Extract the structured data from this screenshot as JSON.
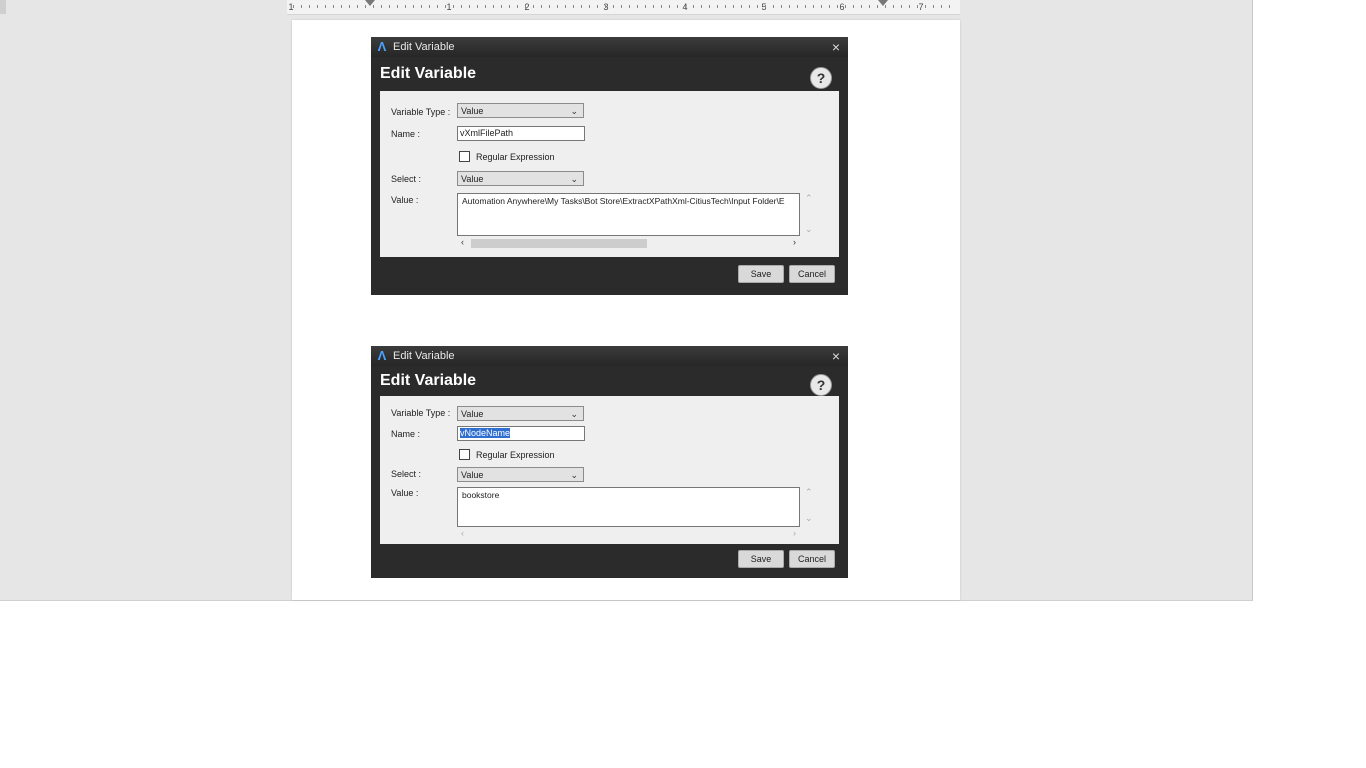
{
  "ruler": {
    "numbers": [
      "1",
      "1",
      "2",
      "3",
      "4",
      "5",
      "6",
      "7"
    ]
  },
  "dialog1": {
    "window_title": "Edit Variable",
    "heading": "Edit Variable",
    "help_label": "?",
    "close_label": "×",
    "variable_type_label": "Variable Type :",
    "variable_type_value": "Value",
    "name_label": "Name :",
    "name_value": "vXmlFilePath",
    "regex_label": "Regular Expression",
    "select_label": "Select :",
    "select_value": "Value",
    "value_label": "Value :",
    "value_text": "Automation Anywhere\\My Tasks\\Bot Store\\ExtractXPathXml-CitiusTech\\Input Folder\\E",
    "save_label": "Save",
    "cancel_label": "Cancel"
  },
  "dialog2": {
    "window_title": "Edit Variable",
    "heading": "Edit Variable",
    "help_label": "?",
    "close_label": "×",
    "variable_type_label": "Variable Type :",
    "variable_type_value": "Value",
    "name_label": "Name :",
    "name_value": "vNodeName",
    "regex_label": "Regular Expression",
    "select_label": "Select :",
    "select_value": "Value",
    "value_label": "Value :",
    "value_text": "bookstore",
    "save_label": "Save",
    "cancel_label": "Cancel"
  }
}
